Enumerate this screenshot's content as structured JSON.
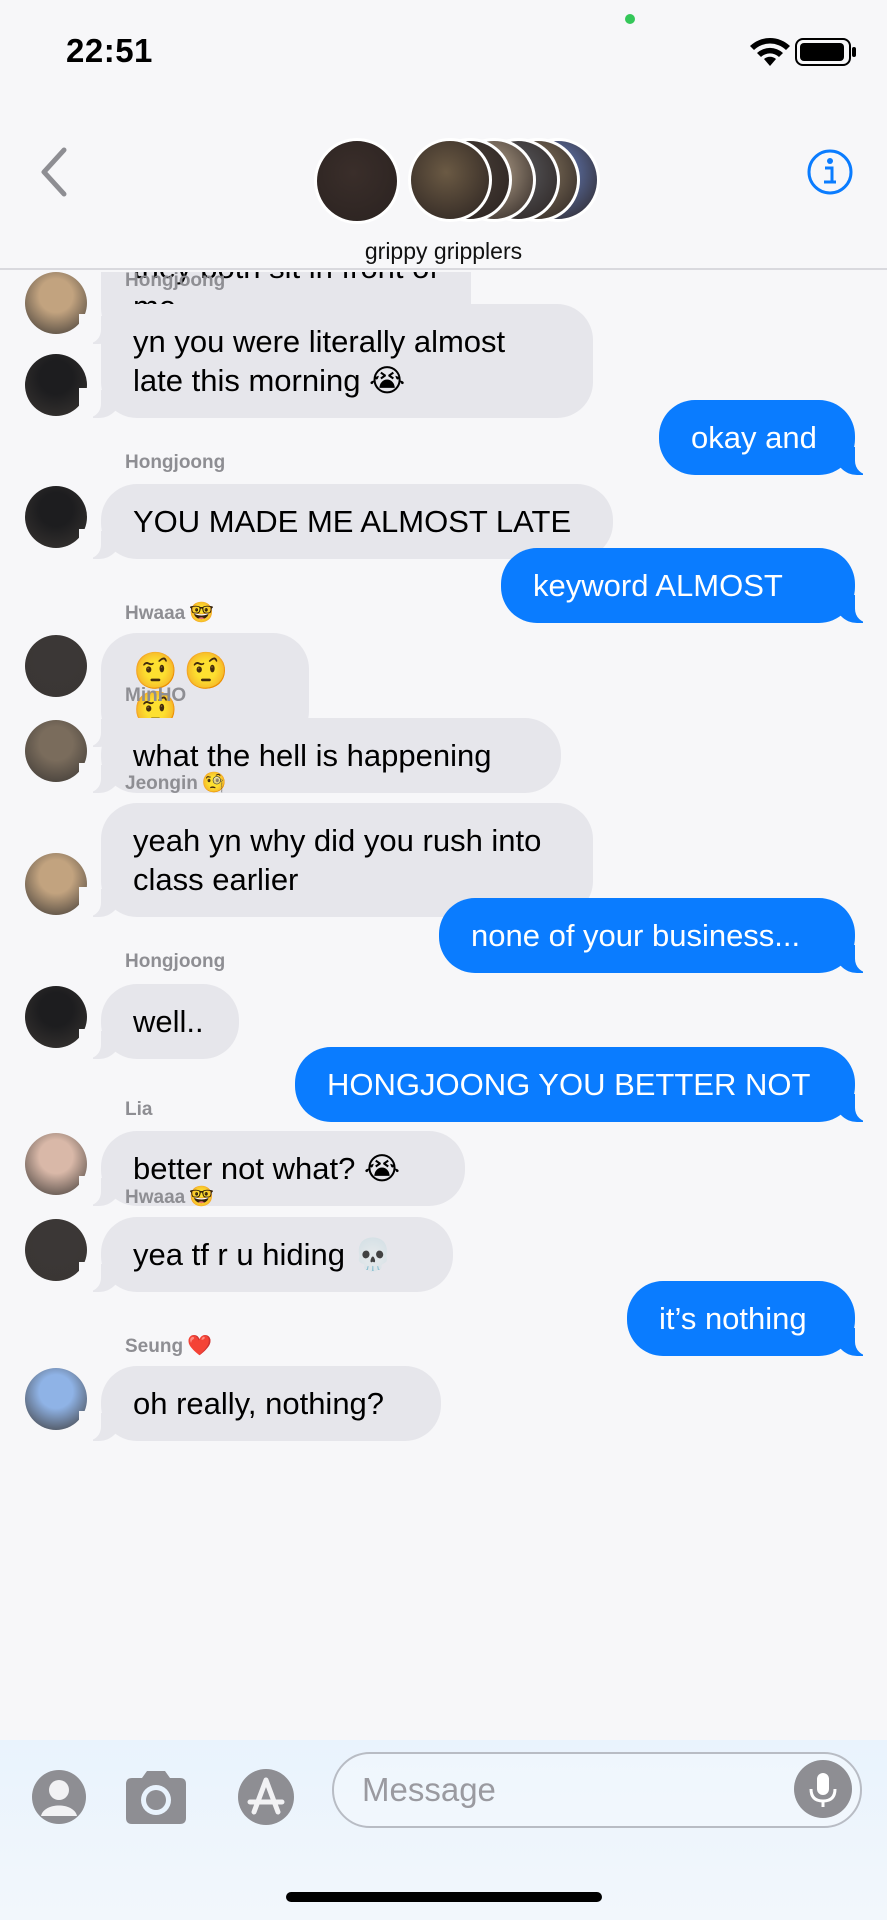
{
  "status_bar": {
    "time": "22:51"
  },
  "header": {
    "back_icon": "chevron-left-icon",
    "info_icon": "info-circle-icon",
    "group_name": "grippy gripplers",
    "avatar_colors": [
      "#3a2e2a",
      "#6b5a44",
      "#4a4038",
      "#b7a58e",
      "#5b5c60",
      "#8a7a62",
      "#6a85c9"
    ]
  },
  "colors": {
    "accent": "#0a7cff",
    "incoming_bubble": "#e6e6eb",
    "background": "#f7f7f9"
  },
  "messages": [
    {
      "direction": "incoming",
      "sender": "",
      "text": "they both sit in front of me",
      "avatar_color": "#c2a37f"
    },
    {
      "direction": "incoming",
      "sender": "Hongjoong",
      "text": "yn you were literally almost late this morning 😭",
      "avatar_color": "#1d1d1f"
    },
    {
      "direction": "outgoing",
      "text": "okay and"
    },
    {
      "direction": "incoming",
      "sender": "Hongjoong",
      "text": "YOU MADE ME ALMOST LATE",
      "avatar_color": "#1d1d1f"
    },
    {
      "direction": "outgoing",
      "text": "keyword ALMOST"
    },
    {
      "direction": "incoming",
      "sender": "Hwaaa",
      "sender_emoji": "🤓",
      "text": "🤨🤨🤨",
      "avatar_color": "#3b3736"
    },
    {
      "direction": "incoming",
      "sender": "MinHO",
      "text": "what the hell is happening",
      "avatar_color": "#7a6c5c"
    },
    {
      "direction": "incoming",
      "sender": "Jeongin",
      "sender_emoji": "🧐",
      "text": "yeah yn why did you rush into class earlier",
      "avatar_color": "#c2a37f"
    },
    {
      "direction": "outgoing",
      "text": "none of your business..."
    },
    {
      "direction": "incoming",
      "sender": "Hongjoong",
      "text": "well..",
      "avatar_color": "#1d1d1f"
    },
    {
      "direction": "outgoing",
      "text": "HONGJOONG YOU BETTER NOT"
    },
    {
      "direction": "incoming",
      "sender": "Lia",
      "text": "better not what? 😭",
      "avatar_color": "#d9b8a8"
    },
    {
      "direction": "incoming",
      "sender": "Hwaaa",
      "sender_emoji": "🤓",
      "text": "yea tf r u hiding 💀",
      "avatar_color": "#3b3736"
    },
    {
      "direction": "outgoing",
      "text": "it’s nothing"
    },
    {
      "direction": "incoming",
      "sender": "Seung",
      "sender_emoji": "❤️",
      "text": "oh really, nothing?",
      "avatar_color": "#8fb3e6"
    }
  ],
  "input_bar": {
    "placeholder": "Message",
    "contact_icon": "person-icon",
    "camera_icon": "camera-icon",
    "apps_icon": "app-store-icon",
    "mic_icon": "microphone-icon"
  }
}
